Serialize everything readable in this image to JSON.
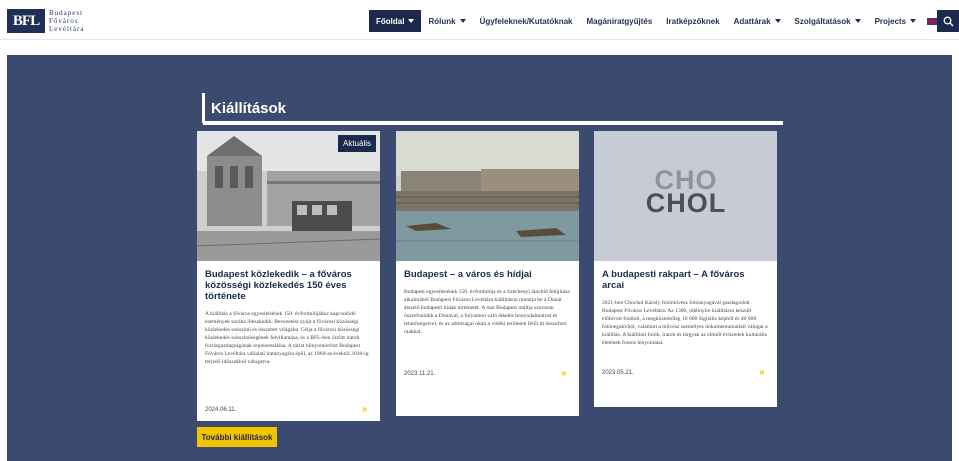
{
  "logo": {
    "mark": "BFL",
    "lines": [
      "Budapest",
      "Főváros",
      "Levéltára"
    ]
  },
  "nav": {
    "items": [
      {
        "label": "Főoldal",
        "caret": true
      },
      {
        "label": "Rólunk",
        "caret": true
      },
      {
        "label": "Ügyfeleknek/Kutatóknak",
        "caret": false
      },
      {
        "label": "Magániratgyűjtés",
        "caret": false
      },
      {
        "label": "Iratképzőknek",
        "caret": false
      },
      {
        "label": "Adattárak",
        "caret": true
      },
      {
        "label": "Szolgáltatások",
        "caret": true
      },
      {
        "label": "Projects",
        "caret": true
      }
    ]
  },
  "section": {
    "title": "Kiállítások"
  },
  "cards": [
    {
      "badge": "Aktuális",
      "title": "Budapest közlekedik – a főváros közösségi közlekedés 150 éves története",
      "text": "A kiállítás a főváros egyesítésének 150. évfordulójához kapcsolódó események sorába illeszkedik. Bevezetést nyújt a fővárosi közösségi közlekedés sokszínű és összetett világába. Célja a fővárosi közösségi közlekedés sokszínűségének felvillantása, és a BFL-ben őrzött iratok forrásgazdagságának reprezentálása. A tárlat túlnyomórészt Budapest Főváros Levéltára vállalati iratanyagára épül, az 1860-as évektől 2010-ig terjedő időszakból válogatva.",
      "date": "2024.06.11.",
      "arrow": "»"
    },
    {
      "title": "Budapest – a város és hídjai",
      "text": "Budapest egyesítésének 150. évfordulója és a Széchenyi lánchíd felújítása alkalmából Budapest Főváros Levéltára kiállításon mutatja be a Dunát átszelő budapesti hidak történetét. A mai Budapest múltja szorosan összefonódik a Dunával, a folyamon való átkelés bonyodalmaival és lehetőségeivel, és az adottságai okán a vidéki területek felől itt összefutó utakkal.",
      "date": "2023.11.21.",
      "arrow": "»"
    },
    {
      "title": "A budapesti rakpart – A főváros arcai",
      "image_text": [
        "CHO",
        "CHOL"
      ],
      "text": "2021-ben Chochol Károly fotóművész fotóanyagával gazdagodott Budapest Főváros Levéltára. Az 1300, többnyire kiállításra készült előhívott fotóból, a megközelítőleg 10 000 digitális képből és 40 000 fotónegatívból, valamint a művész személyes dokumentumaiból válogat a kiállítás. A kiállított fotók, iratok és tárgyak az elmúlt évtizedek kulturális életének fontos lenyomatai.",
      "date": "2023.05.21.",
      "arrow": "»"
    }
  ],
  "more_button": "További kiállítások",
  "colors": {
    "navy": "#1b2a4c",
    "band": "#3b4b6f",
    "accent_yellow": "#f2c400"
  },
  "icons": [
    "search-icon",
    "flag-uk-icon",
    "flag-de-icon",
    "chevron-right-icon"
  ]
}
